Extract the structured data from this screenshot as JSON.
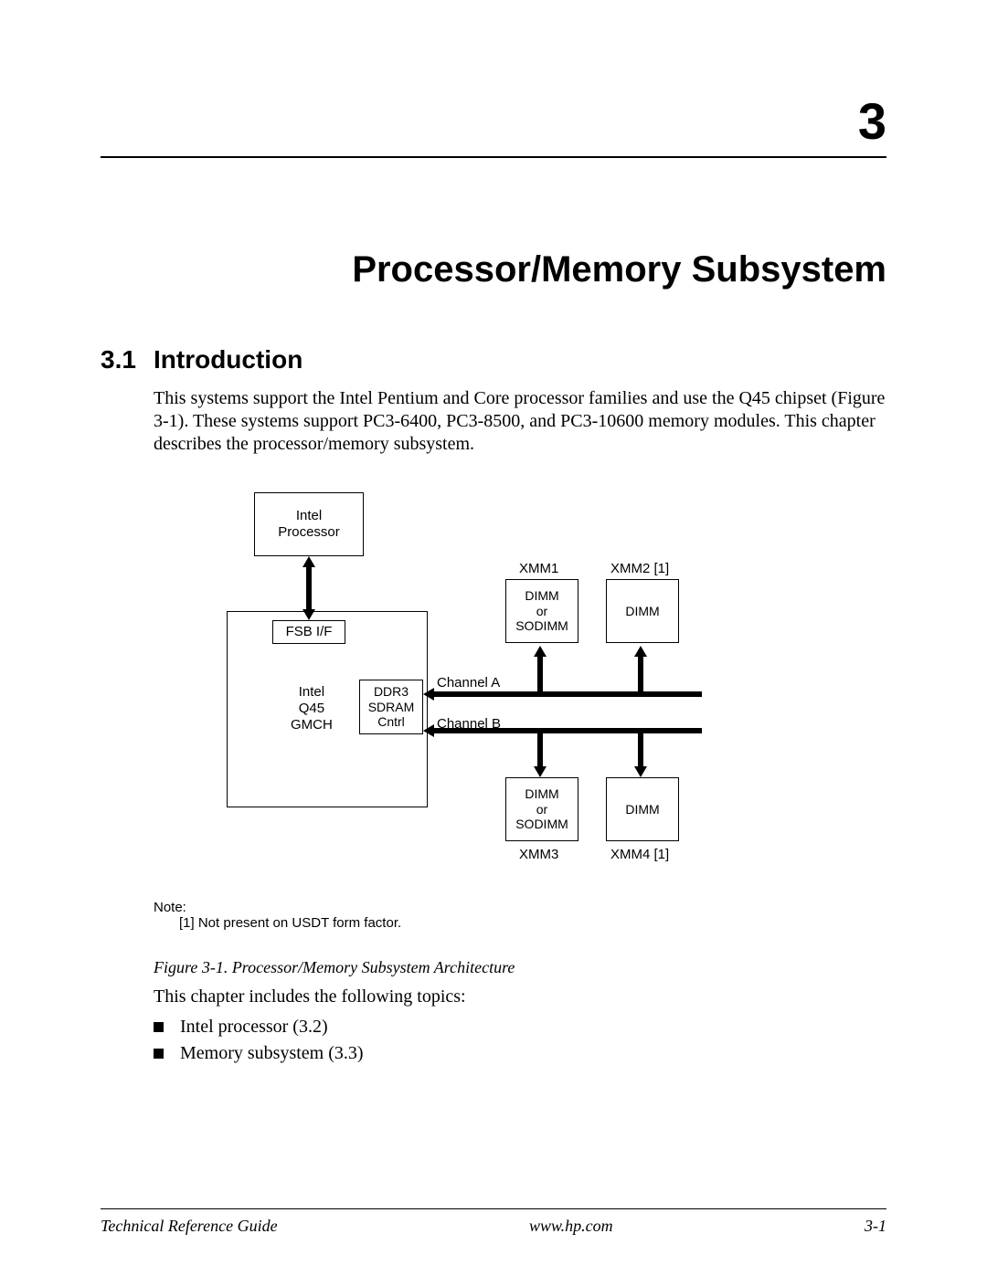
{
  "chapter": {
    "number": "3",
    "title": "Processor/Memory Subsystem"
  },
  "section": {
    "number": "3.1",
    "title": "Introduction"
  },
  "intro_paragraph": "This systems support the Intel Pentium and Core processor families and use the Q45 chipset (Figure 3-1). These systems support PC3-6400, PC3-8500, and PC3-10600 memory modules. This chapter describes the processor/memory subsystem.",
  "diagram": {
    "processor_box": "Intel\nProcessor",
    "fsb_label": "FSB I/F",
    "gmch_label": "Intel\nQ45\nGMCH",
    "ddr_label": "DDR3\nSDRAM\nCntrl",
    "channel_a": "Channel A",
    "channel_b": "Channel B",
    "xmm1": "XMM1",
    "xmm2": "XMM2 [1]",
    "xmm3": "XMM3",
    "xmm4": "XMM4 [1]",
    "dimm_or_sodimm": "DIMM\nor\nSODIMM",
    "dimm": "DIMM"
  },
  "note": {
    "label": "Note:",
    "text": "[1] Not present on USDT form factor."
  },
  "figure_caption": "Figure 3-1.   Processor/Memory Subsystem Architecture",
  "topics_intro": "This chapter includes the following topics:",
  "topics": [
    "Intel processor (3.2)",
    "Memory subsystem (3.3)"
  ],
  "footer": {
    "left": "Technical Reference Guide",
    "center": "www.hp.com",
    "right": "3-1"
  }
}
